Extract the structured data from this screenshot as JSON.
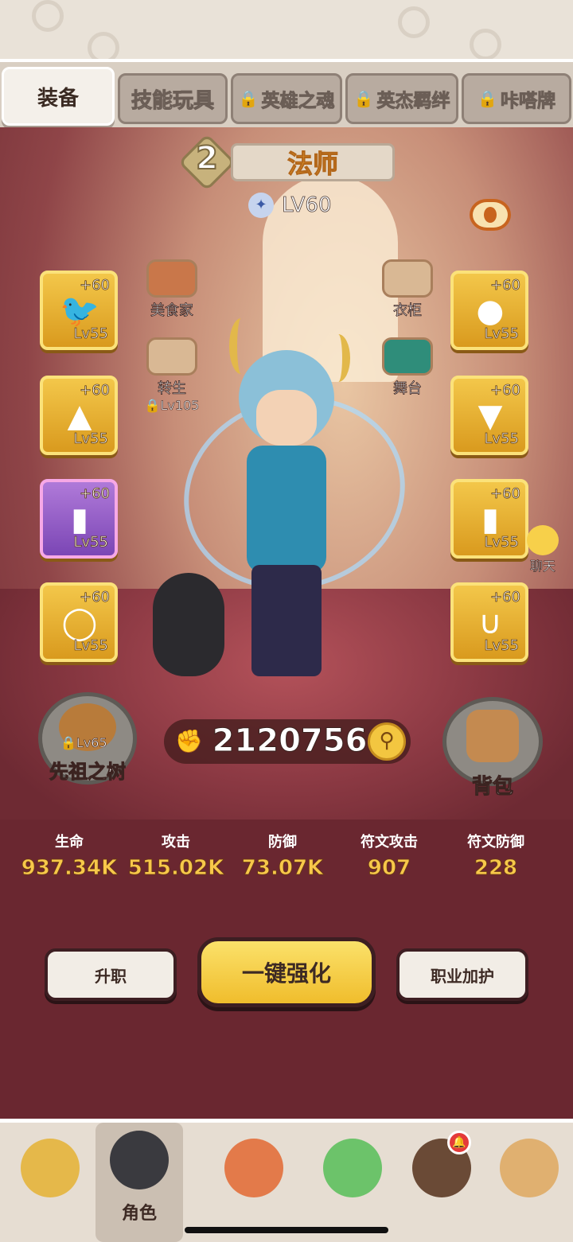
{
  "tabs": [
    {
      "label": "装备",
      "locked": false,
      "active": true
    },
    {
      "label": "技能玩具",
      "locked": false,
      "active": false
    },
    {
      "label": "英雄之魂",
      "locked": true,
      "active": false
    },
    {
      "label": "英杰羁绊",
      "locked": true,
      "active": false
    },
    {
      "label": "咔嗒牌",
      "locked": true,
      "active": false
    }
  ],
  "hero": {
    "tier": "2",
    "class_name": "法师",
    "level": "LV60"
  },
  "left_slots": [
    {
      "plus": "+60",
      "level": "Lv55",
      "icon": "bird-helmet-icon",
      "rarity": "gold"
    },
    {
      "plus": "+60",
      "level": "Lv55",
      "icon": "beak-mask-icon",
      "rarity": "gold"
    },
    {
      "plus": "+60",
      "level": "Lv55",
      "icon": "bracer-icon",
      "rarity": "purple"
    },
    {
      "plus": "+60",
      "level": "Lv55",
      "icon": "ring-icon",
      "rarity": "gold"
    }
  ],
  "right_slots": [
    {
      "plus": "+60",
      "level": "Lv55",
      "icon": "orb-icon",
      "rarity": "gold"
    },
    {
      "plus": "+60",
      "level": "Lv55",
      "icon": "cloak-icon",
      "rarity": "gold"
    },
    {
      "plus": "+60",
      "level": "Lv55",
      "icon": "gauntlet-icon",
      "rarity": "gold"
    },
    {
      "plus": "+60",
      "level": "Lv55",
      "icon": "necklace-icon",
      "rarity": "gold"
    }
  ],
  "side_items": {
    "gourmet": "美食家",
    "rebirth": "转生",
    "rebirth_lock": "Lv105",
    "wardrobe": "衣柜",
    "stage": "舞台"
  },
  "chat_label": "聊天",
  "ancestor_tree": {
    "label": "先祖之树",
    "lock": "Lv65"
  },
  "power": "2120756",
  "backpack_label": "背包",
  "stats": [
    {
      "name": "生命",
      "value": "937.34K"
    },
    {
      "name": "攻击",
      "value": "515.02K"
    },
    {
      "name": "防御",
      "value": "73.07K"
    },
    {
      "name": "符文攻击",
      "value": "907"
    },
    {
      "name": "符文防御",
      "value": "228"
    }
  ],
  "buttons": {
    "promote": "升职",
    "enhance_all": "一键强化",
    "class_protect": "职业加护"
  },
  "nav": [
    {
      "label": "",
      "icon": "hay-character-icon",
      "active": false
    },
    {
      "label": "角色",
      "icon": "hero-character-icon",
      "active": true
    },
    {
      "label": "",
      "icon": "tiki-character-icon",
      "active": false
    },
    {
      "label": "",
      "icon": "dino-character-icon",
      "active": false
    },
    {
      "label": "",
      "icon": "bear-character-icon",
      "active": false,
      "notification": true
    },
    {
      "label": "",
      "icon": "shop-character-icon",
      "active": false
    }
  ],
  "colors": {
    "background": "#6a2730",
    "slot_gold": "#f3c74a",
    "slot_purple": "#b07ad9",
    "stat_value": "#f7c84a",
    "class_name": "#f2a830"
  }
}
